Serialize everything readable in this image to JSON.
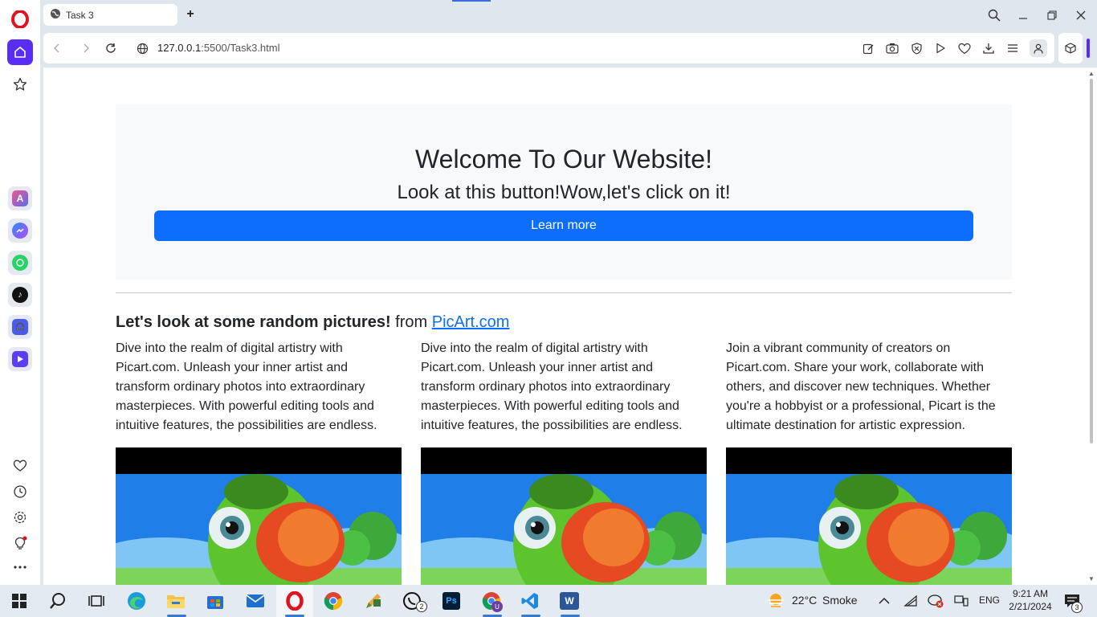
{
  "browser": {
    "tab_title": "Task 3",
    "url_host": "127.0.0.1",
    "url_rest": ":5500/Task3.html"
  },
  "page": {
    "hero_title": "Welcome To Our Website!",
    "hero_subtitle": "Look at this button!Wow,let's click on it!",
    "hero_button": "Learn more",
    "section_title_bold": "Let's look at some random pictures!",
    "section_title_from": " from ",
    "section_title_link": "PicArt.com",
    "columns": [
      {
        "text": "Dive into the realm of digital artistry with Picart.com. Unleash your inner artist and transform ordinary photos into extraordinary masterpieces. With powerful editing tools and intuitive features, the possibilities are endless."
      },
      {
        "text": "Dive into the realm of digital artistry with Picart.com. Unleash your inner artist and transform ordinary photos into extraordinary masterpieces. With powerful editing tools and intuitive features, the possibilities are endless."
      },
      {
        "text": "Join a vibrant community of creators on Picart.com. Share your work, collaborate with others, and discover new techniques. Whether you're a hobbyist or a professional, Picart is the ultimate destination for artistic expression."
      }
    ]
  },
  "taskbar": {
    "weather_temp": "22°C",
    "weather_desc": "Smoke",
    "language": "ENG",
    "time": "9:21 AM",
    "date": "2/21/2024",
    "whatsapp_badge": "2",
    "notification_count": "3",
    "chrome_profile_initial": "U"
  },
  "colors": {
    "opera_accent": "#5a2df5",
    "button_blue": "#0d6efd",
    "link_blue": "#0d6efd"
  }
}
